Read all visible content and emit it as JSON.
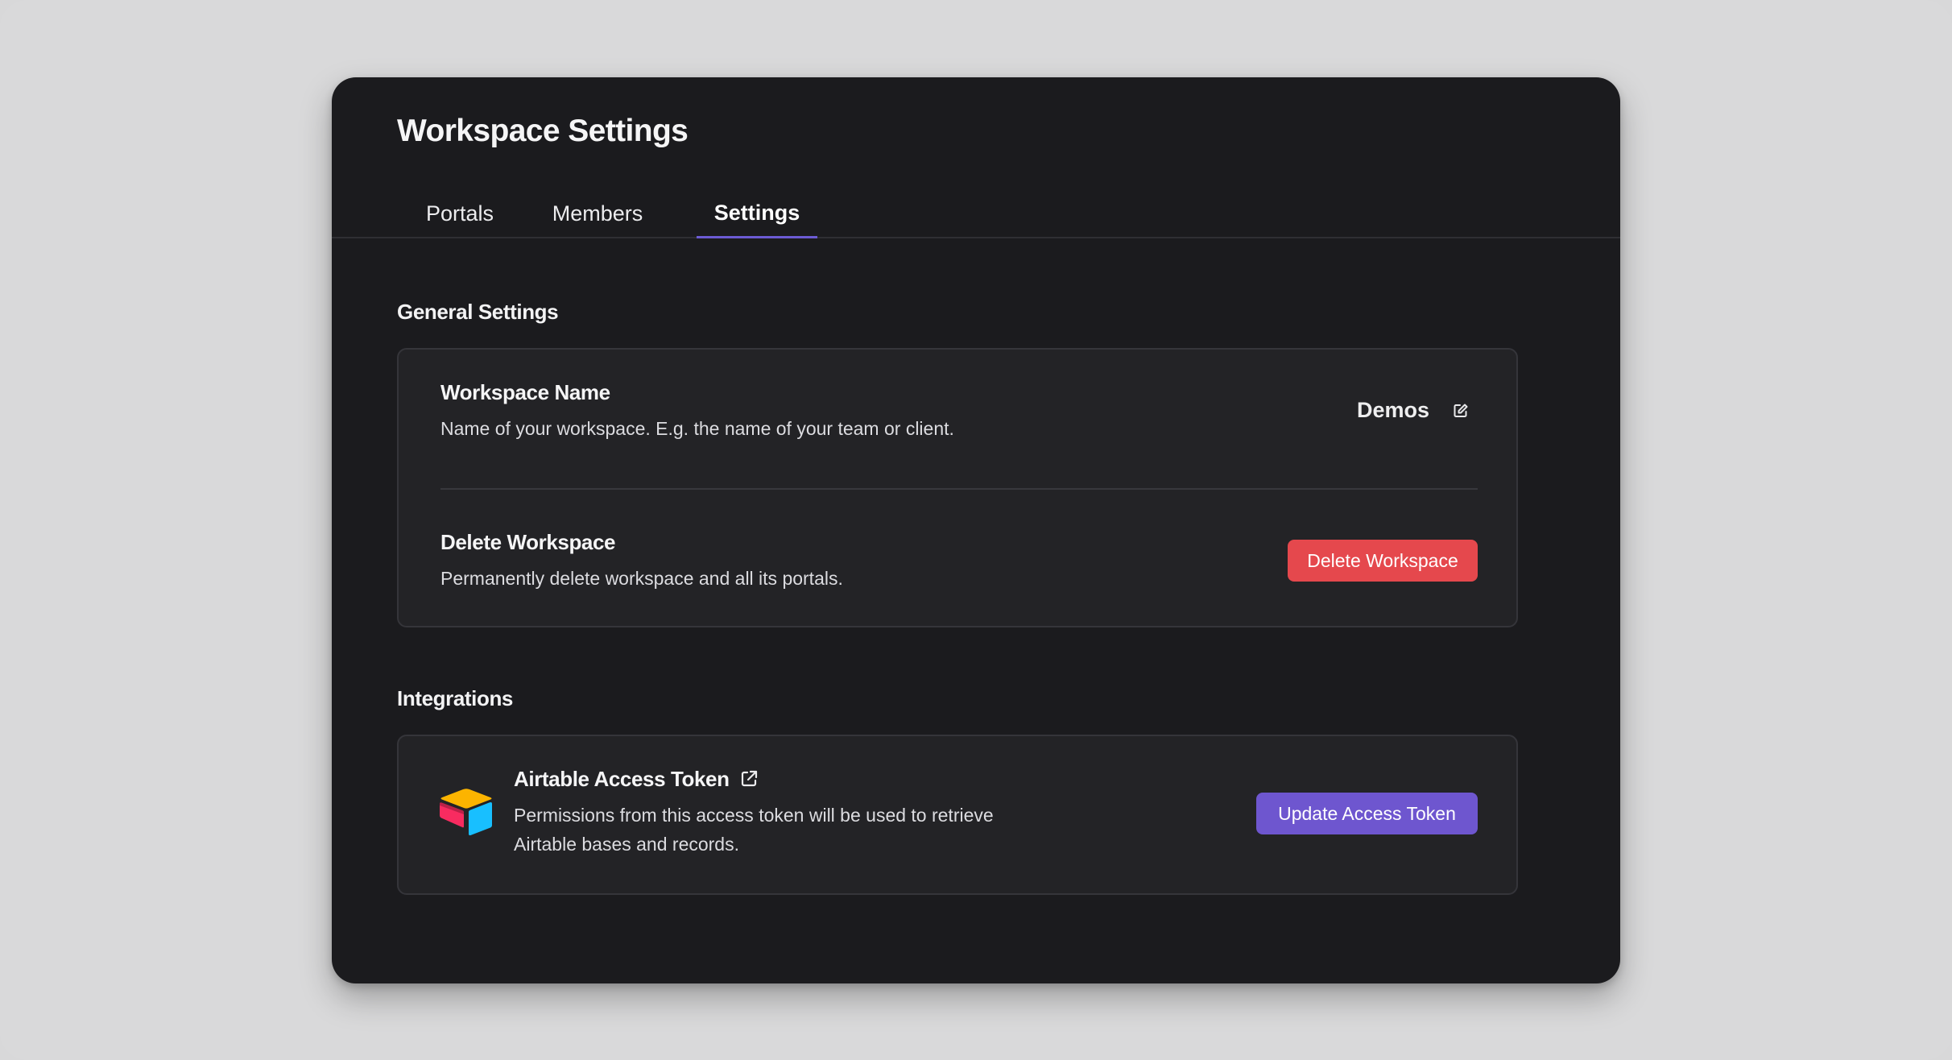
{
  "page": {
    "title": "Workspace Settings"
  },
  "tabs": [
    {
      "label": "Portals",
      "active": false
    },
    {
      "label": "Members",
      "active": false
    },
    {
      "label": "Settings",
      "active": true
    }
  ],
  "general": {
    "section_title": "General Settings",
    "workspace_name": {
      "title": "Workspace Name",
      "description": "Name of your workspace. E.g. the name of your team or client.",
      "value": "Demos",
      "edit_icon": "edit-icon"
    },
    "delete_workspace": {
      "title": "Delete Workspace",
      "description": "Permanently delete workspace and all its portals.",
      "button_label": "Delete Workspace"
    }
  },
  "integrations": {
    "section_title": "Integrations",
    "airtable": {
      "logo_icon": "airtable-logo",
      "title": "Airtable Access Token",
      "link_icon": "external-link-icon",
      "description_line1": "Permissions from this access token will be used to retrieve",
      "description_line2": "Airtable bases and records.",
      "button_label": "Update Access Token"
    }
  },
  "colors": {
    "background": "#d8d8d9",
    "window": "#1b1b1e",
    "card": "#232326",
    "accent": "#6e56cf",
    "danger": "#e5484d",
    "tab_indicator": "#6c5bd4"
  }
}
